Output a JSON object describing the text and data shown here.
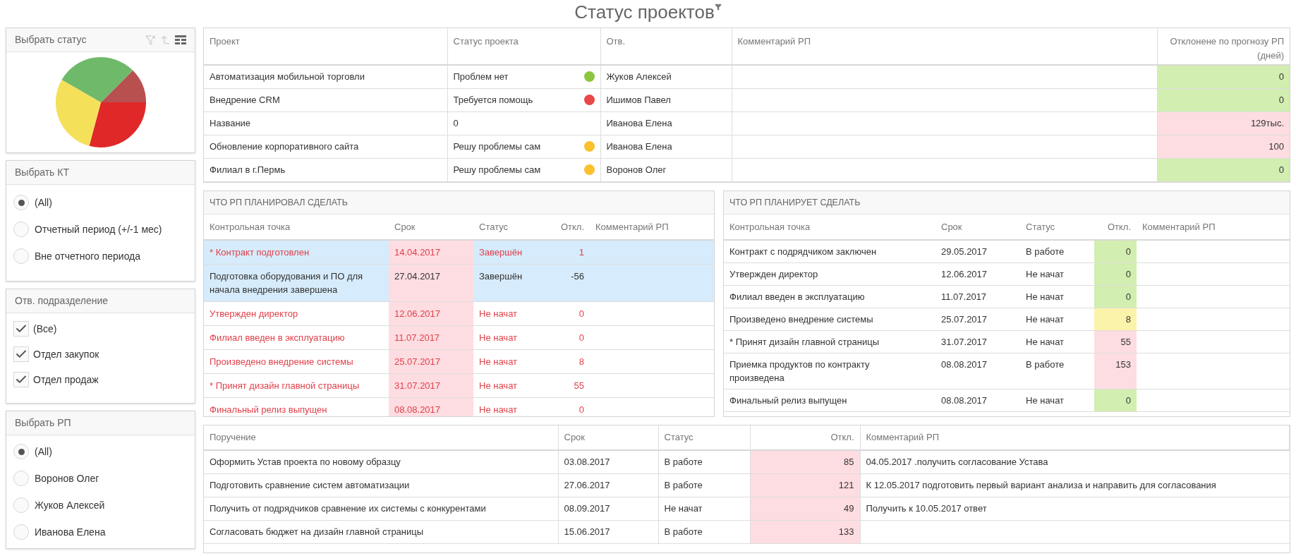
{
  "page": {
    "title": "Статус проектов"
  },
  "status_filter": {
    "title": "Выбрать статус"
  },
  "kt_filter": {
    "title": "Выбрать КТ",
    "options": [
      {
        "label": "(All)",
        "selected": true
      },
      {
        "label": "Отчетный период (+/-1 мес)",
        "selected": false
      },
      {
        "label": "Вне отчетного периода",
        "selected": false
      }
    ]
  },
  "department_filter": {
    "title": "Отв. подразделение",
    "options": [
      {
        "label": "(Все)",
        "checked": true
      },
      {
        "label": "Отдел закупок",
        "checked": true
      },
      {
        "label": "Отдел продаж",
        "checked": true
      }
    ]
  },
  "pm_filter": {
    "title": "Выбрать РП",
    "options": [
      {
        "label": "(All)",
        "selected": true
      },
      {
        "label": "Воронов Олег",
        "selected": false
      },
      {
        "label": "Жуков Алексей",
        "selected": false
      },
      {
        "label": "Иванова Елена",
        "selected": false
      }
    ]
  },
  "projects_table": {
    "columns": [
      "Проект",
      "Статус проекта",
      "Отв.",
      "Комментарий РП",
      "Отклонене по прогнозу РП (дней)"
    ],
    "rows": [
      {
        "project": "Автоматизация мобильной торговли",
        "status": "Проблем нет",
        "color": "#8cc63f",
        "owner": "Жуков Алексей",
        "deviation": {
          "value": "0",
          "color": "#d2eeb0"
        }
      },
      {
        "project": "Внедрение CRM",
        "status": "Требуется помощь",
        "color": "#e84848",
        "owner": "Ишимов Павел",
        "deviation": {
          "value": "0",
          "color": "#d2eeb0"
        }
      },
      {
        "project": "Название",
        "status": "0",
        "owner": "Иванова Елена",
        "deviation": {
          "value": "129тыс.",
          "color": "#fddde1"
        }
      },
      {
        "project": "Обновление корпоративного сайта",
        "status": "Решу проблемы сам",
        "color": "#fbc02d",
        "owner": "Иванова Елена",
        "deviation": {
          "value": "100",
          "color": "#fddde1"
        }
      },
      {
        "project": "Филиал в г.Пермь",
        "status": "Решу проблемы сам",
        "color": "#fbc02d",
        "owner": "Воронов Олег",
        "deviation": {
          "value": "0",
          "color": "#d2eeb0"
        }
      }
    ]
  },
  "planned": {
    "title": "ЧТО РП ПЛАНИРОВАЛ СДЕЛАТЬ",
    "columns": [
      "Контрольная точка",
      "Срок",
      "Статус",
      "Откл.",
      "Комментарий РП"
    ],
    "rows": [
      {
        "checkpoint": "* Контракт подготовлен",
        "date": "14.04.2017",
        "status": "Завершён",
        "deviation": "1",
        "selected": true,
        "overdue": true,
        "date_late": true
      },
      {
        "checkpoint": "Подготовка оборудования и ПО для начала внедрения завершена",
        "date": "27.04.2017",
        "status": "Завершён",
        "deviation": "-56",
        "selected": true,
        "overdue": false,
        "date_late": true
      },
      {
        "checkpoint": "Утвержден директор",
        "date": "12.06.2017",
        "status": "Не начат",
        "deviation": "0",
        "selected": false,
        "overdue": true,
        "date_late": true
      },
      {
        "checkpoint": "Филиал введен в эксплуатацию",
        "date": "11.07.2017",
        "status": "Не начат",
        "deviation": "0",
        "selected": false,
        "overdue": true,
        "date_late": true
      },
      {
        "checkpoint": "Произведено внедрение системы",
        "date": "25.07.2017",
        "status": "Не начат",
        "deviation": "8",
        "selected": false,
        "overdue": true,
        "date_late": true
      },
      {
        "checkpoint": "* Принят дизайн главной страницы",
        "date": "31.07.2017",
        "status": "Не начат",
        "deviation": "55",
        "selected": false,
        "overdue": true,
        "date_late": true
      },
      {
        "checkpoint": "Финальный релиз выпущен",
        "date": "08.08.2017",
        "status": "Не начат",
        "deviation": "0",
        "selected": false,
        "overdue": true,
        "date_late": true
      }
    ]
  },
  "planning": {
    "title": "ЧТО РП ПЛАНИРУЕТ СДЕЛАТЬ",
    "columns": [
      "Контрольная точка",
      "Срок",
      "Статус",
      "Откл.",
      "Комментарий РП"
    ],
    "rows": [
      {
        "checkpoint": "Контракт с подрядчиком заключен",
        "date": "29.05.2017",
        "status": "В работе",
        "deviation": {
          "value": "0",
          "color": "#d2eeb0"
        }
      },
      {
        "checkpoint": "Утвержден директор",
        "date": "12.06.2017",
        "status": "Не начат",
        "deviation": {
          "value": "0",
          "color": "#d2eeb0"
        }
      },
      {
        "checkpoint": "Филиал введен в эксплуатацию",
        "date": "11.07.2017",
        "status": "Не начат",
        "deviation": {
          "value": "0",
          "color": "#d2eeb0"
        }
      },
      {
        "checkpoint": "Произведено внедрение системы",
        "date": "25.07.2017",
        "status": "Не начат",
        "deviation": {
          "value": "8",
          "color": "#fcf3aa"
        }
      },
      {
        "checkpoint": "* Принят дизайн главной страницы",
        "date": "31.07.2017",
        "status": "Не начат",
        "deviation": {
          "value": "55",
          "color": "#fddde1"
        }
      },
      {
        "checkpoint": "Приемка продуктов по контракту произведена",
        "date": "08.08.2017",
        "status": "В работе",
        "deviation": {
          "value": "153",
          "color": "#fddde1"
        }
      },
      {
        "checkpoint": "Финальный релиз выпущен",
        "date": "08.08.2017",
        "status": "Не начат",
        "deviation": {
          "value": "0",
          "color": "#d2eeb0"
        }
      }
    ]
  },
  "tasks": {
    "columns": [
      "Поручение",
      "Срок",
      "Статус",
      "Откл.",
      "Комментарий РП"
    ],
    "rows": [
      {
        "task": "Оформить Устав проекта по новому образцу",
        "date": "03.08.2017",
        "status": "В работе",
        "deviation": {
          "value": "85",
          "color": "#fddde1"
        },
        "comment": "04.05.2017 .получить согласование Устава"
      },
      {
        "task": "Подготовить сравнение систем автоматизации",
        "date": "27.06.2017",
        "status": "В работе",
        "deviation": {
          "value": "121",
          "color": "#fddde1"
        },
        "comment": "К 12.05.2017 подготовить первый вариант анализа и направить для согласования"
      },
      {
        "task": "Получить от подрядчиков сравнение их системы с конкурентами",
        "date": "08.09.2017",
        "status": "Не начат",
        "deviation": {
          "value": "49",
          "color": "#fddde1"
        },
        "comment": "Получить к 10.05.2017 ответ"
      },
      {
        "task": "Согласовать бюджет на дизайн главной страницы",
        "date": "15.06.2017",
        "status": "В работе",
        "deviation": {
          "value": "133",
          "color": "#fddde1"
        }
      }
    ]
  }
}
